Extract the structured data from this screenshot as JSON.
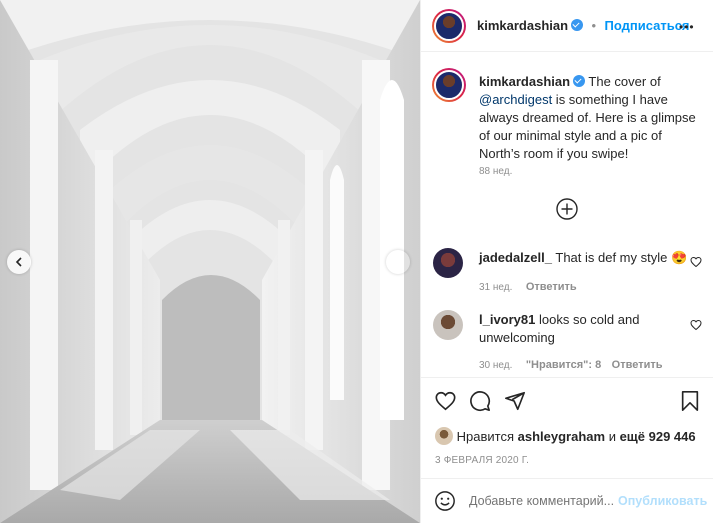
{
  "post": {
    "username": "kimkardashian",
    "follow_label": "Подписаться",
    "more_label": "•••",
    "caption_user": "kimkardashian",
    "caption_pre": " The cover of",
    "caption_mention": "@archdigest",
    "caption_post": " is something I have always dreamed of. Here is a glimpse of our minimal style and a pic of North’s room if you swipe!",
    "caption_time": "88 нед."
  },
  "comments": [
    {
      "user": "jadedalzell_",
      "text": "That is def my style 😍",
      "time": "31 нед.",
      "reply": "Ответить"
    },
    {
      "user": "l_ivory81",
      "text": "looks so cold and unwelcoming",
      "time": "30 нед.",
      "likes": "\"Нравится\": 8",
      "reply": "Ответить"
    }
  ],
  "likes": {
    "prefix": "Нравится",
    "user": "ashleygraham",
    "conj": "и",
    "count": "ещё 929 446"
  },
  "date": "3 ФЕВРАЛЯ 2020 Г.",
  "comment_box": {
    "placeholder": "Добавьте комментарий...",
    "publish": "Опубликовать"
  },
  "colors": {
    "accent": "#0095f6",
    "verified": "#3897f0",
    "muted": "#8e8e8e",
    "border": "#efefef"
  },
  "icons": [
    "chevron-left-icon",
    "chevron-right-icon",
    "more-icon",
    "plus-circle-icon",
    "heart-icon",
    "comment-icon",
    "share-icon",
    "bookmark-icon",
    "emoji-icon"
  ]
}
